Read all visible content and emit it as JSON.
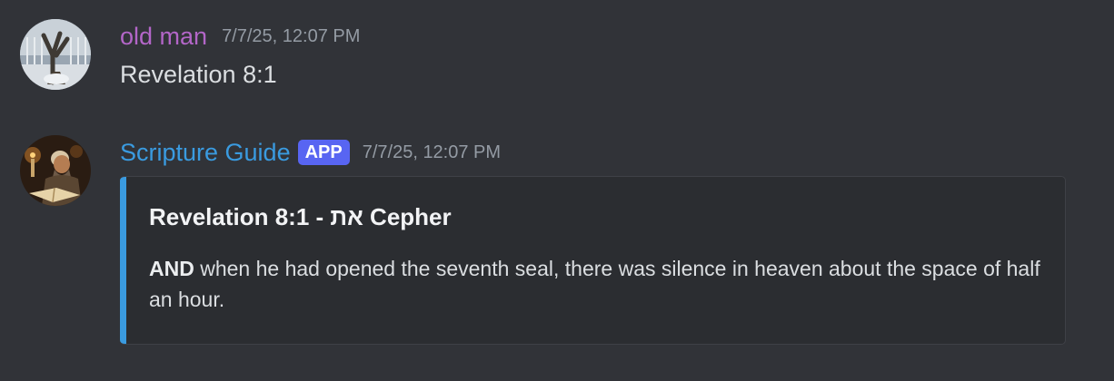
{
  "messages": [
    {
      "author": "old man",
      "timestamp": "7/7/25, 12:07 PM",
      "content": "Revelation 8:1",
      "avatar_icon": "tree-sculpture-avatar-icon"
    },
    {
      "author": "Scripture Guide",
      "badge": "APP",
      "timestamp": "7/7/25, 12:07 PM",
      "avatar_icon": "scholar-reading-avatar-icon",
      "embed": {
        "title": "Revelation 8:1 - את Cepher",
        "description_lead": "AND",
        "description_rest": " when he had opened the seventh seal, there was silence in heaven about the space of half an hour.",
        "accent_color": "#3a9be0"
      }
    }
  ],
  "colors": {
    "background": "#313338",
    "author1": "#b366c8",
    "author2": "#3a9be0",
    "badge": "#5865f2",
    "embed_bg": "#2b2d31"
  }
}
